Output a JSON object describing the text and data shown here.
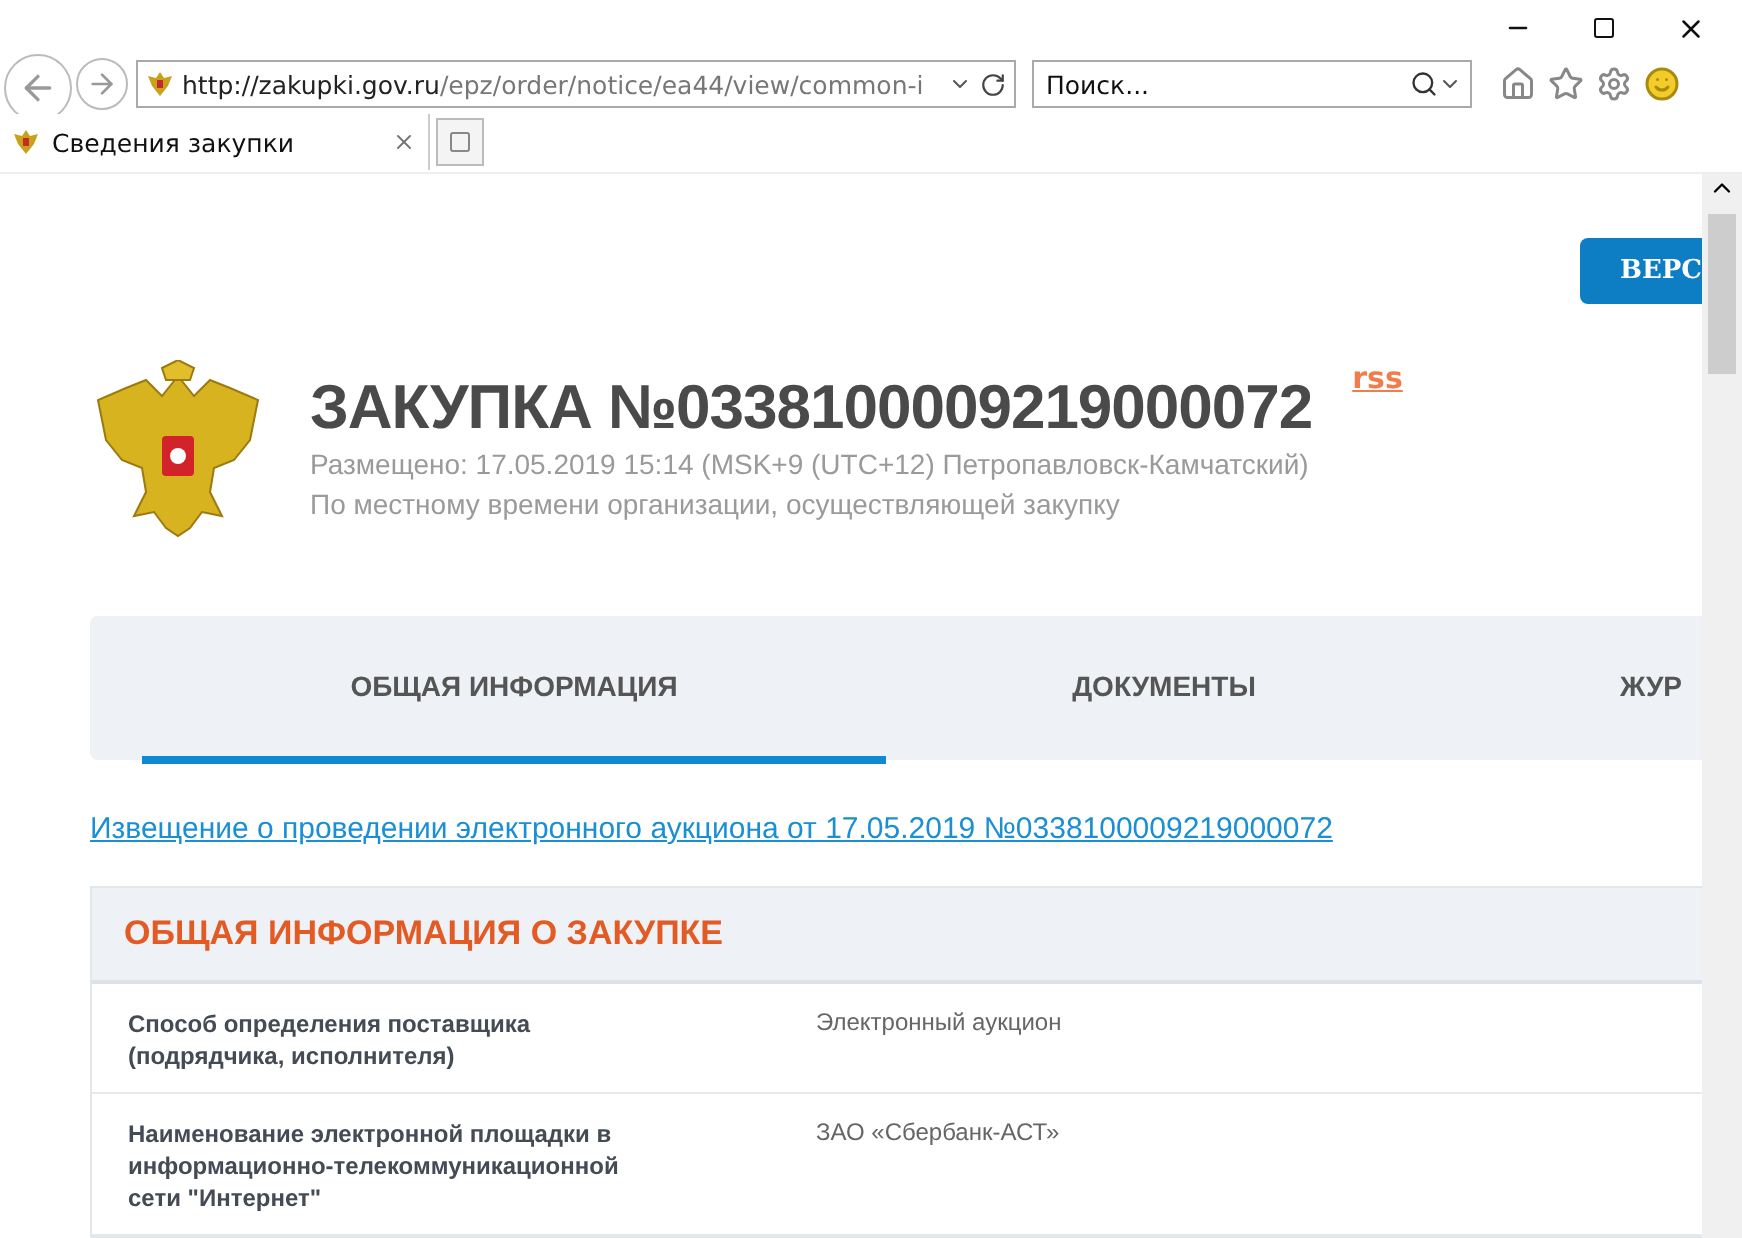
{
  "browser": {
    "url_host": "http://zakupki.gov.ru",
    "url_path": "/epz/order/notice/ea44/view/common-i",
    "search": {
      "placeholder": "Поиск..."
    },
    "tab_title": "Сведения закупки"
  },
  "page": {
    "version_button": "ВЕРС",
    "title": "ЗАКУПКА №0338100009219000072",
    "rss": "rss",
    "posted": "Размещено: 17.05.2019 15:14 (MSK+9 (UTC+12) Петропавловск-Камчатский)",
    "time_note": "По местному времени организации, осуществляющей закупку",
    "tabs": [
      {
        "label": "ОБЩАЯ ИНФОРМАЦИЯ",
        "selected": true
      },
      {
        "label": "ДОКУМЕНТЫ",
        "selected": false
      },
      {
        "label": "ЖУР",
        "selected": false
      }
    ],
    "notice_link": "Извещение о проведении электронного аукциона от 17.05.2019 №0338100009219000072",
    "section": {
      "title": "ОБЩАЯ ИНФОРМАЦИЯ О ЗАКУПКЕ",
      "rows": [
        {
          "label": "Способ определения поставщика (подрядчика, исполнителя)",
          "value": "Электронный аукцион"
        },
        {
          "label": "Наименование электронной площадки в информационно-телекоммуникационной сети \"Интернет\"",
          "value": "ЗАО «Сбербанк-АСТ»"
        }
      ]
    }
  }
}
